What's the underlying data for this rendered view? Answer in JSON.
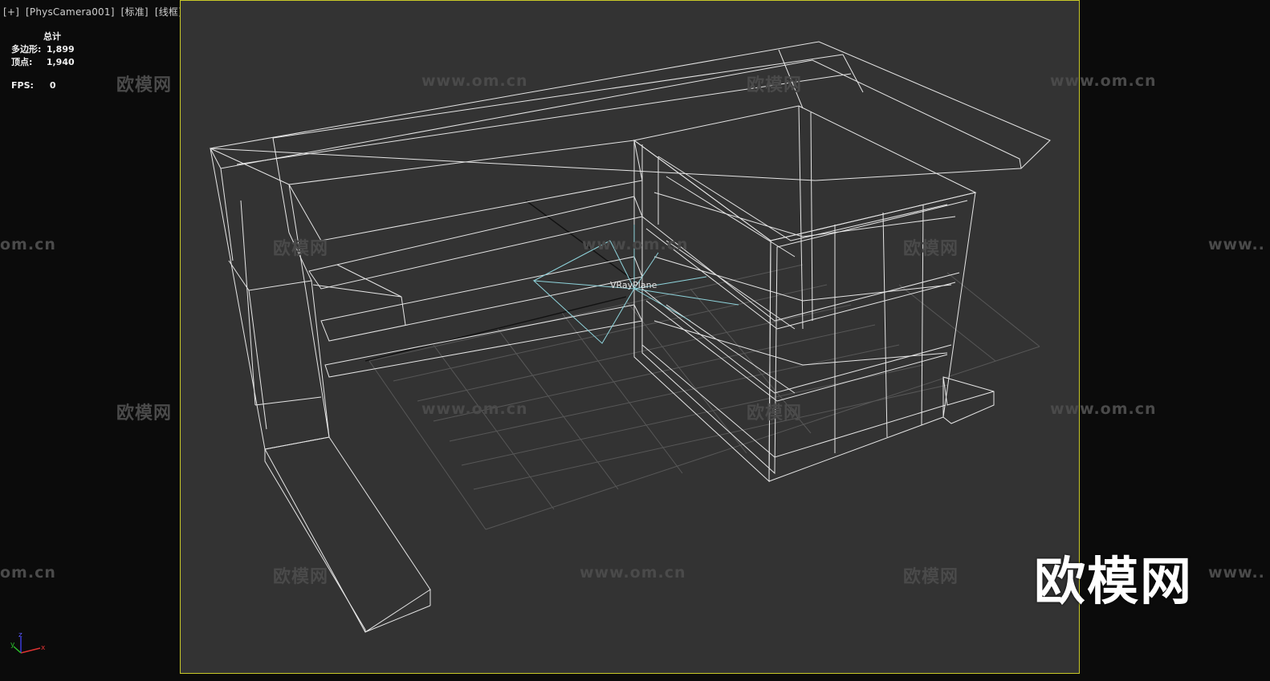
{
  "viewport_menu": {
    "plus_label": "[+]",
    "camera_label": "[PhysCamera001]",
    "shading_label": "[标准]",
    "display_label": "[线框]"
  },
  "stats": {
    "header": "总计",
    "polygons_label": "多边形:",
    "polygons_value": "1,899",
    "vertices_label": "顶点:",
    "vertices_value": "1,940",
    "fps_label": "FPS:",
    "fps_value": "0"
  },
  "scene": {
    "object_label": "VRayPlane"
  },
  "watermarks": {
    "brand_cn": "欧模网",
    "url": "www.om.cn",
    "url_partial": "om.cn",
    "url_start": "www.."
  },
  "axis": {
    "x": "x",
    "y": "y",
    "z": "z"
  },
  "colors": {
    "viewport_border": "#c9c928",
    "viewport_bg": "#333333",
    "wireframe": "#e6e6e6",
    "helper": "#8fd4dc"
  }
}
